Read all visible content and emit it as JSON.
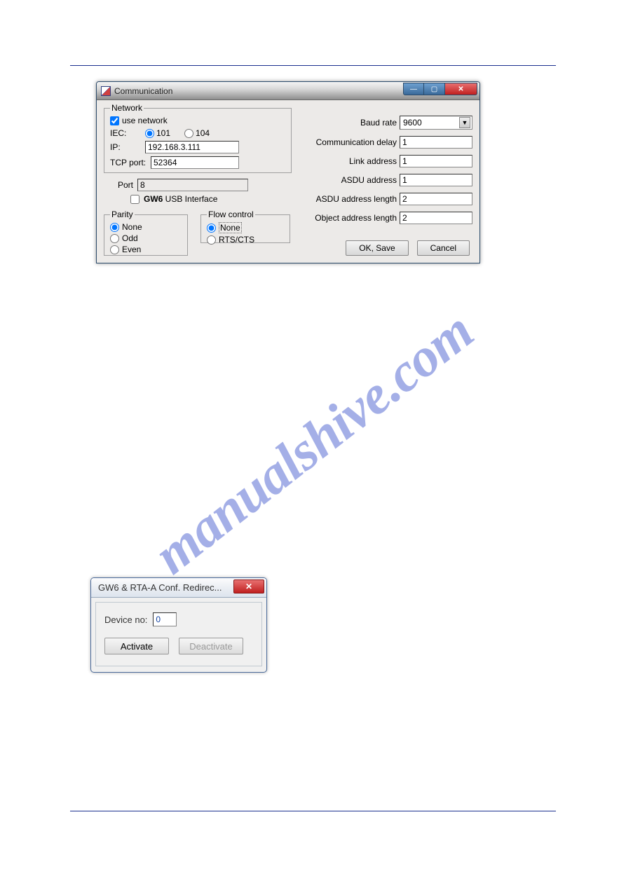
{
  "watermark": "manualshive.com",
  "win1": {
    "title": "Communication",
    "network": {
      "legend": "Network",
      "use_network": "use network",
      "use_network_checked": true,
      "iec_label": "IEC:",
      "iec_101": "101",
      "iec_104": "104",
      "ip_label": "IP:",
      "ip_value": "192.168.3.111",
      "tcp_label": "TCP port:",
      "tcp_value": "52364"
    },
    "port_label": "Port",
    "port_value": "8",
    "gw6_label_pre": "",
    "gw6_bold": "GW6",
    "gw6_label_post": " USB Interface",
    "parity": {
      "legend": "Parity",
      "none": "None",
      "odd": "Odd",
      "even": "Even"
    },
    "flow": {
      "legend": "Flow control",
      "none": "None",
      "rtscts": "RTS/CTS"
    },
    "right": {
      "baud_label": "Baud rate",
      "baud_value": "9600",
      "comm_delay_label": "Communication delay",
      "comm_delay_value": "1",
      "link_addr_label": "Link address",
      "link_addr_value": "1",
      "asdu_addr_label": "ASDU address",
      "asdu_addr_value": "1",
      "asdu_len_label": "ASDU address length",
      "asdu_len_value": "2",
      "obj_len_label": "Object address length",
      "obj_len_value": "2"
    },
    "buttons": {
      "ok": "OK, Save",
      "cancel": "Cancel"
    }
  },
  "win2": {
    "title": "GW6 & RTA-A Conf. Redirec...",
    "device_label": "Device no:",
    "device_value": "0",
    "activate": "Activate",
    "deactivate": "Deactivate"
  }
}
